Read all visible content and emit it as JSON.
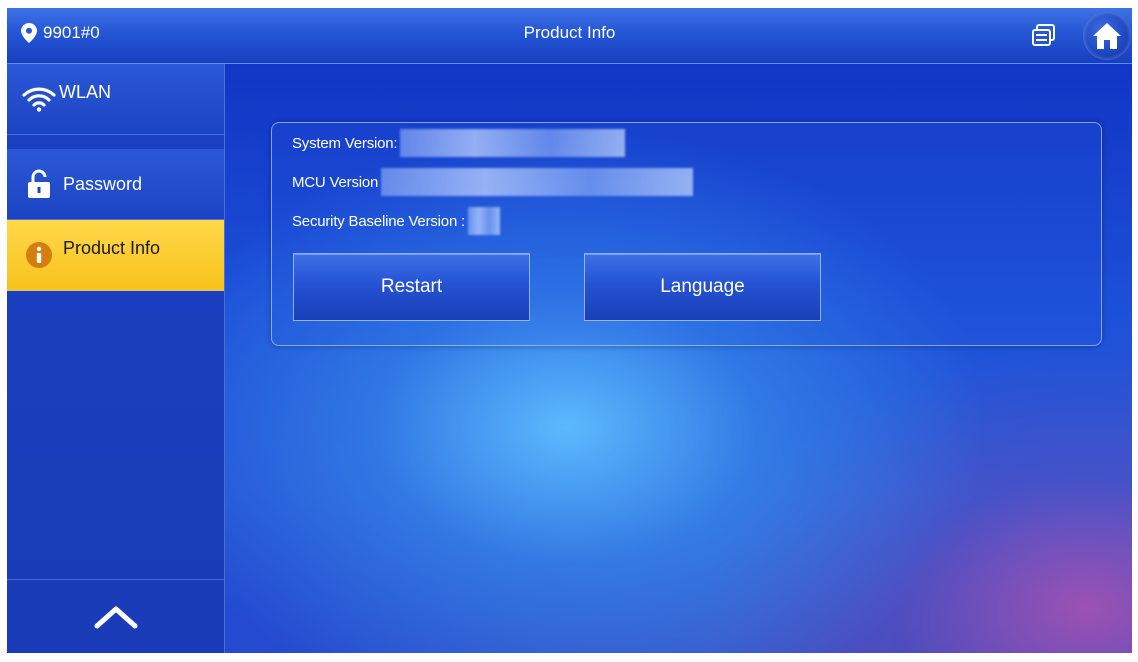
{
  "topbar": {
    "location": "9901#0",
    "title": "Product Info"
  },
  "sidebar": {
    "items": [
      {
        "label": "WLAN",
        "icon": "wifi-icon"
      },
      {
        "label": "Password",
        "icon": "lock-icon"
      },
      {
        "label": "Product Info",
        "icon": "info-icon",
        "active": true
      }
    ]
  },
  "info": {
    "system_version_label": "System Version:",
    "mcu_version_label": "MCU Version",
    "security_baseline_label": "Security Baseline Version :"
  },
  "buttons": {
    "restart": "Restart",
    "language": "Language"
  },
  "colors": {
    "accent_active": "#f7c21c",
    "topbar": "#2456d6",
    "background": "#1c4fd8"
  }
}
